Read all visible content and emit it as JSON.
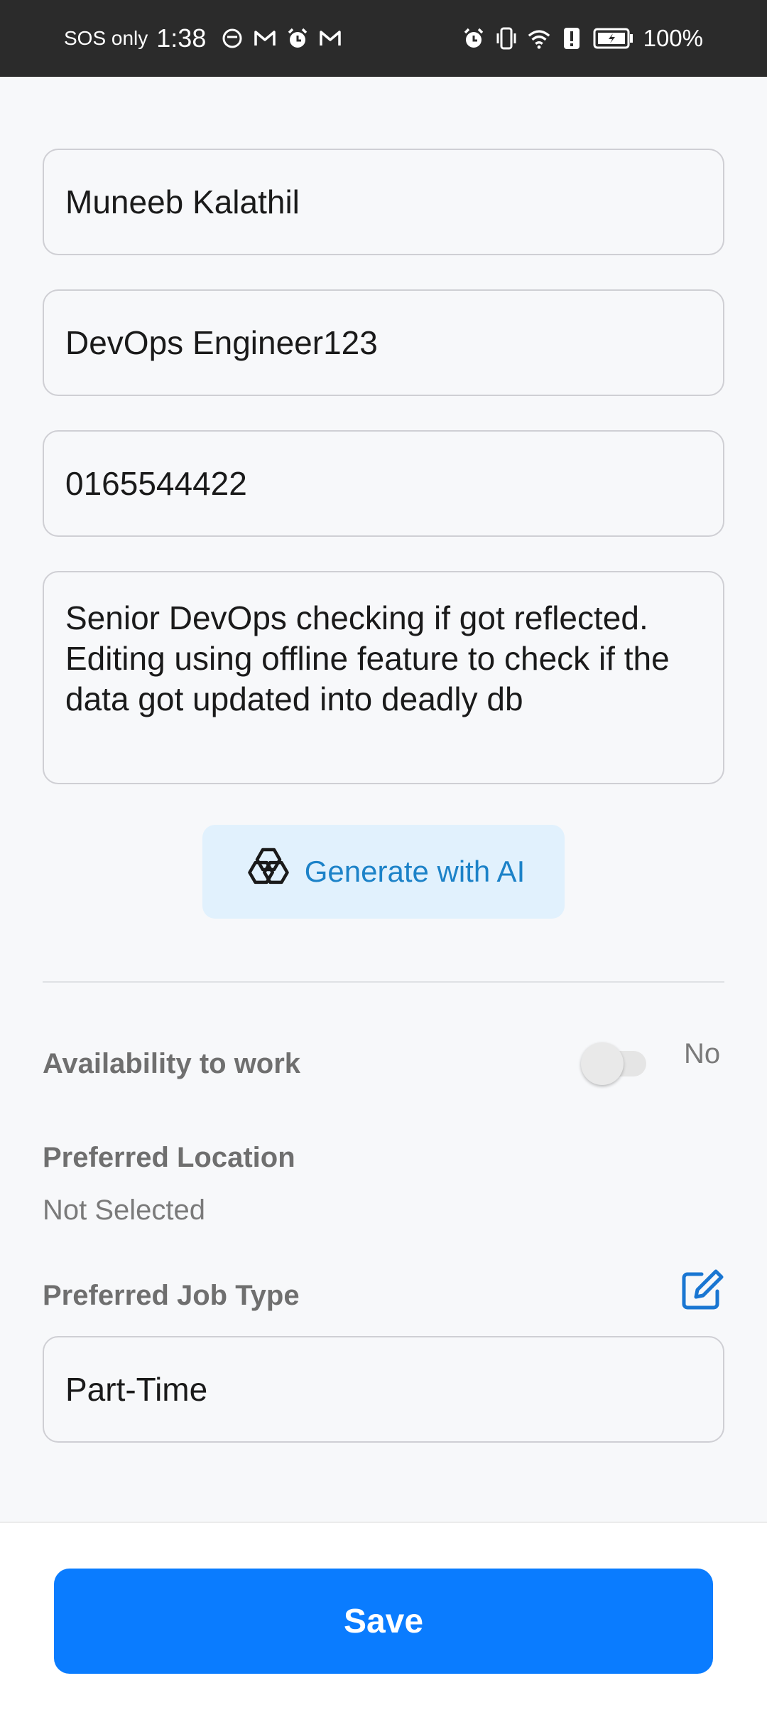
{
  "status_bar": {
    "sos_text": "SOS only",
    "time": "1:38",
    "battery_pct": "100%"
  },
  "form": {
    "name_value": "Muneeb Kalathil",
    "title_value": "DevOps Engineer123",
    "phone_value": "0165544422",
    "summary_value": "Senior DevOps  checking if got reflected. Editing using offline feature to check if the data got updated into deadly db",
    "ai_button_label": "Generate with AI",
    "availability_label": "Availability to work",
    "availability_value": "No",
    "preferred_location_label": "Preferred Location",
    "preferred_location_value": "Not Selected",
    "preferred_job_type_label": "Preferred Job Type",
    "preferred_job_type_value": "Part-Time"
  },
  "footer": {
    "save_label": "Save"
  },
  "colors": {
    "primary": "#0a7cff",
    "ai_button_bg": "#e1f1fd",
    "ai_button_text": "#1c82c8",
    "edit_icon": "#1976d2"
  }
}
